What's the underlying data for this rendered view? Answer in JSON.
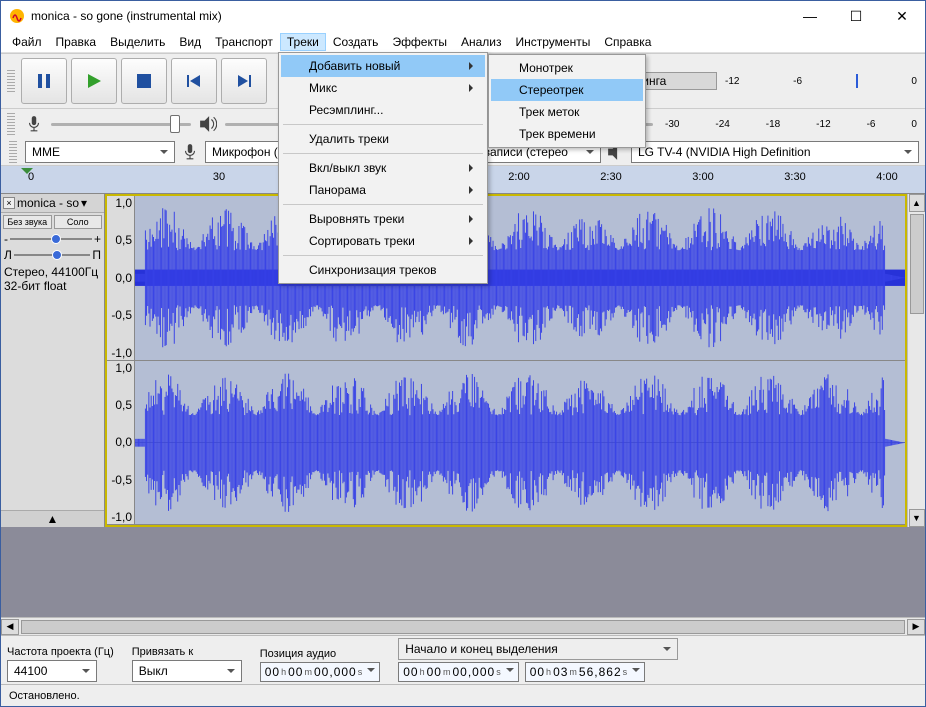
{
  "window": {
    "title": "monica - so gone (instrumental mix)"
  },
  "menu": [
    "Файл",
    "Правка",
    "Выделить",
    "Вид",
    "Транспорт",
    "Треки",
    "Создать",
    "Эффекты",
    "Анализ",
    "Инструменты",
    "Справка"
  ],
  "menu_active_index": 5,
  "tracks_menu": {
    "items": [
      {
        "label": "Добавить новый",
        "sub": true,
        "hl": true
      },
      {
        "label": "Микс",
        "sub": true
      },
      {
        "label": "Ресэмплинг..."
      },
      {
        "sep": true
      },
      {
        "label": "Удалить треки"
      },
      {
        "sep": true
      },
      {
        "label": "Вкл/выкл звук",
        "sub": true
      },
      {
        "label": "Панорама",
        "sub": true
      },
      {
        "sep": true
      },
      {
        "label": "Выровнять треки",
        "sub": true
      },
      {
        "label": "Сортировать треки",
        "sub": true
      },
      {
        "sep": true
      },
      {
        "label": "Синхронизация треков"
      }
    ]
  },
  "add_submenu": {
    "items": [
      "Монотрек",
      "Стереотрек",
      "Трек меток",
      "Трек времени"
    ],
    "hl_index": 1
  },
  "record_hint": "я старта мониторинга",
  "db_top": [
    "-12",
    "-6",
    "0"
  ],
  "db_bot": [
    "-30",
    "-24",
    "-18",
    "-12",
    "-6",
    "0"
  ],
  "device": {
    "host": "MME",
    "input": "Микрофон (H",
    "channels": "па записи (стерео",
    "output": "LG TV-4 (NVIDIA High Definition"
  },
  "timeline": {
    "start_label": "0",
    "marks": [
      "0",
      "30",
      "2:00",
      "2:30",
      "3:00",
      "3:30",
      "4:00"
    ],
    "pos": [
      30,
      218,
      518,
      610,
      702,
      794,
      886
    ]
  },
  "track": {
    "name": "monica - so",
    "mute": "Без звука",
    "solo": "Соло",
    "gain_left": "-",
    "gain_right": "+",
    "pan_left": "Л",
    "pan_right": "П",
    "info1": "Стерео, 44100Гц",
    "info2": "32-бит  float",
    "scale": [
      "1,0",
      "0,5",
      "0,0",
      "-0,5",
      "-1,0"
    ]
  },
  "bottom": {
    "rate_label": "Частота проекта (Гц)",
    "rate": "44100",
    "snap_label": "Привязать к",
    "snap": "Выкл",
    "pos_label": "Позиция аудио",
    "sel_label": "Начало и конец выделения",
    "t_pos": {
      "h": "00",
      "m": "00",
      "s": "00",
      "ms": "000",
      "unit_h": "h",
      "unit_m": "m",
      "unit_s": "s"
    },
    "t_start": {
      "h": "00",
      "m": "00",
      "s": "00",
      "ms": "000"
    },
    "t_end": {
      "h": "00",
      "m": "03",
      "s": "56",
      "ms": "862"
    }
  },
  "status": "Остановлено."
}
